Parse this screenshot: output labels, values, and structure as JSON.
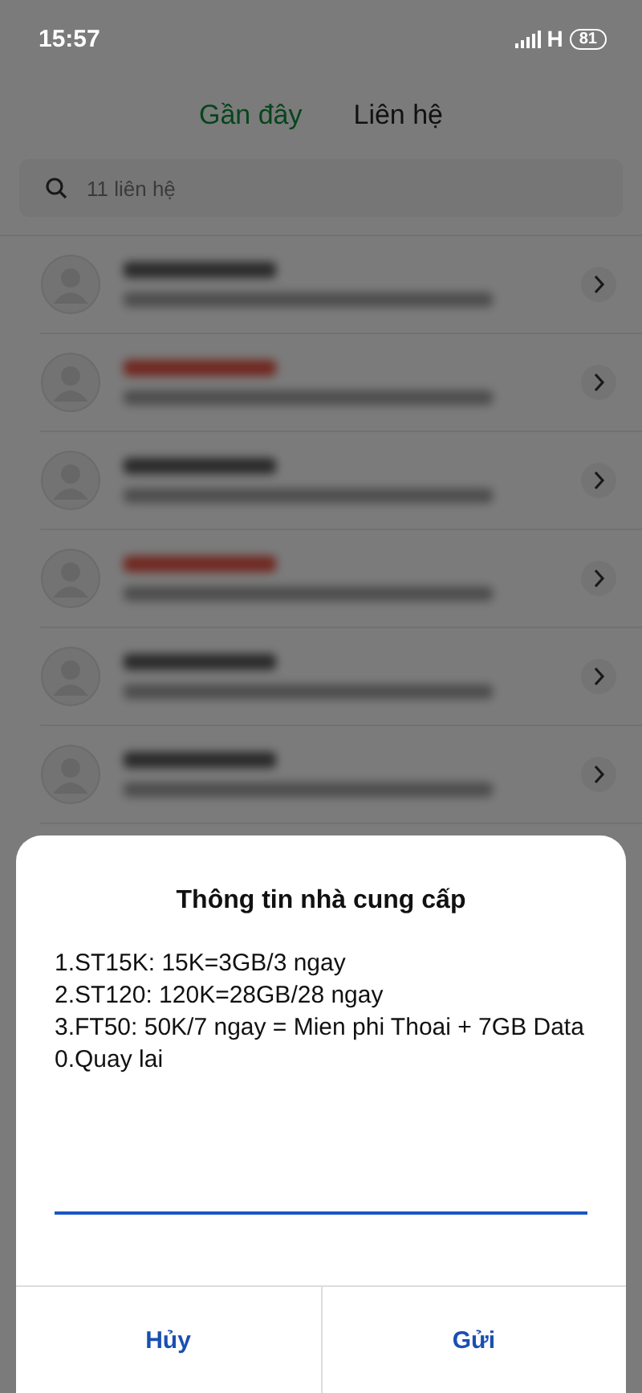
{
  "status_bar": {
    "time": "15:57",
    "network": "H",
    "battery": "81"
  },
  "tabs": [
    {
      "label": "Gần đây",
      "selected": true
    },
    {
      "label": "Liên hệ",
      "selected": false
    }
  ],
  "search": {
    "placeholder": "11 liên hệ"
  },
  "call_log": [
    {
      "missed": false
    },
    {
      "missed": true
    },
    {
      "missed": false
    },
    {
      "missed": true
    },
    {
      "missed": false
    },
    {
      "missed": false
    }
  ],
  "dialog": {
    "title": "Thông tin nhà cung cấp",
    "lines": [
      "1.ST15K: 15K=3GB/3 ngay",
      "2.ST120: 120K=28GB/28 ngay",
      "3.FT50: 50K/7 ngay = Mien phi Thoai + 7GB Data",
      "0.Quay lai"
    ],
    "buttons": [
      "Hủy",
      "Gửi"
    ]
  }
}
